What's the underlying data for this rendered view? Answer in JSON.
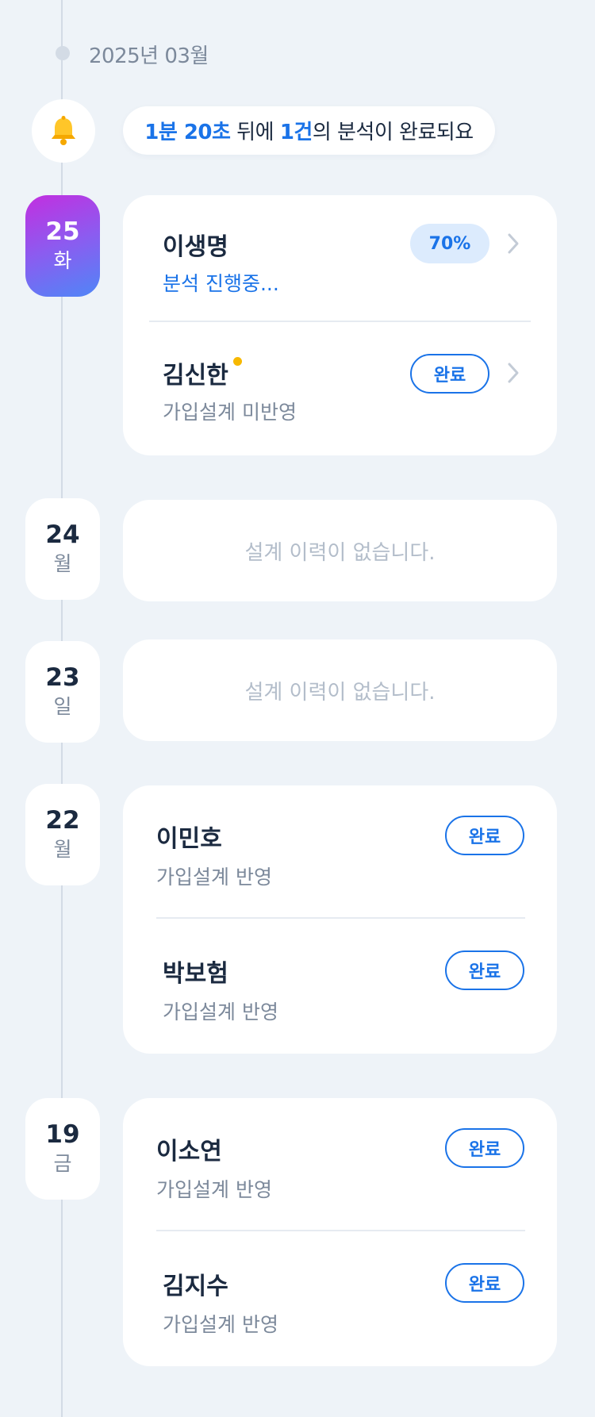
{
  "timeline": {
    "month": "2025년 03월"
  },
  "notice": {
    "time": "1분 20초",
    "mid": " 뒤에 ",
    "count": "1건",
    "tail": "의 분석이 완료되요"
  },
  "days": [
    {
      "day": "25",
      "weekday": "화",
      "active": true,
      "items": [
        {
          "name": "이생명",
          "status": "분석 진행중...",
          "badge": "70%",
          "badge_type": "progress",
          "progress": 70
        },
        {
          "name": "김신한",
          "status": "가입설계 미반영",
          "badge": "완료",
          "badge_type": "done",
          "new": true
        }
      ]
    },
    {
      "day": "24",
      "weekday": "월",
      "empty_text": "설계 이력이 없습니다."
    },
    {
      "day": "23",
      "weekday": "일",
      "empty_text": "설계 이력이 없습니다."
    },
    {
      "day": "22",
      "weekday": "월",
      "items": [
        {
          "name": "이민호",
          "status": "가입설계 반영",
          "badge": "완료"
        },
        {
          "name": "박보험",
          "status": "가입설계 반영",
          "badge": "완료"
        }
      ]
    },
    {
      "day": "19",
      "weekday": "금",
      "items": [
        {
          "name": "이소연",
          "status": "가입설계 반영",
          "badge": "완료"
        },
        {
          "name": "김지수",
          "status": "가입설계 반영",
          "badge": "완료"
        }
      ]
    }
  ],
  "colors": {
    "accent": "#1a73e8",
    "background": "#eef3f8",
    "new_dot": "#f7b800"
  }
}
